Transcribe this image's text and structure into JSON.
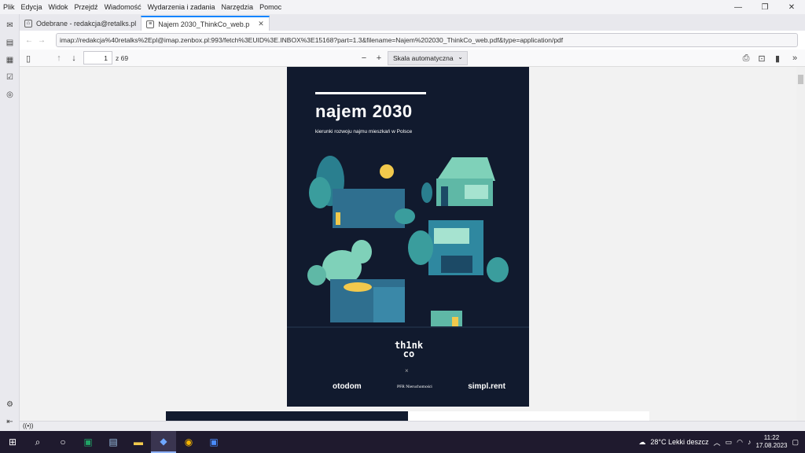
{
  "menu": [
    "Plik",
    "Edycja",
    "Widok",
    "Przejdź",
    "Wiadomość",
    "Wydarzenia i zadania",
    "Narzędzia",
    "Pomoc"
  ],
  "tabs": [
    {
      "label": "Odebrane - redakcja@retalks.pl"
    },
    {
      "label": "Najem 2030_ThinkCo_web.p"
    }
  ],
  "url": "imap://redakcja%40retalks%2Epl@imap.zenbox.pl:993/fetch%3EUID%3E.INBOX%3E15168?part=1.3&filename=Najem%202030_ThinkCo_web.pdf&type=application/pdf",
  "pdf": {
    "page": "1",
    "page_count": "z 69",
    "zoom": "Skala automatyczna"
  },
  "cover": {
    "title": "najem 2030",
    "subtitle": "kierunki rozwoju najmu mieszkań w Polsce",
    "brand_line1": "th1nk",
    "brand_line2": "co",
    "cross": "×",
    "partner1": "otodom",
    "partner2": "PFR Nieruchomości",
    "partner3": "simpl.rent"
  },
  "taskbar": {
    "weather": "28°C  Lekki deszcz",
    "time": "11:22",
    "date": "17.08.2023"
  },
  "colors": {
    "page_bg": "#111a2e",
    "accent": "#0a84ff"
  }
}
